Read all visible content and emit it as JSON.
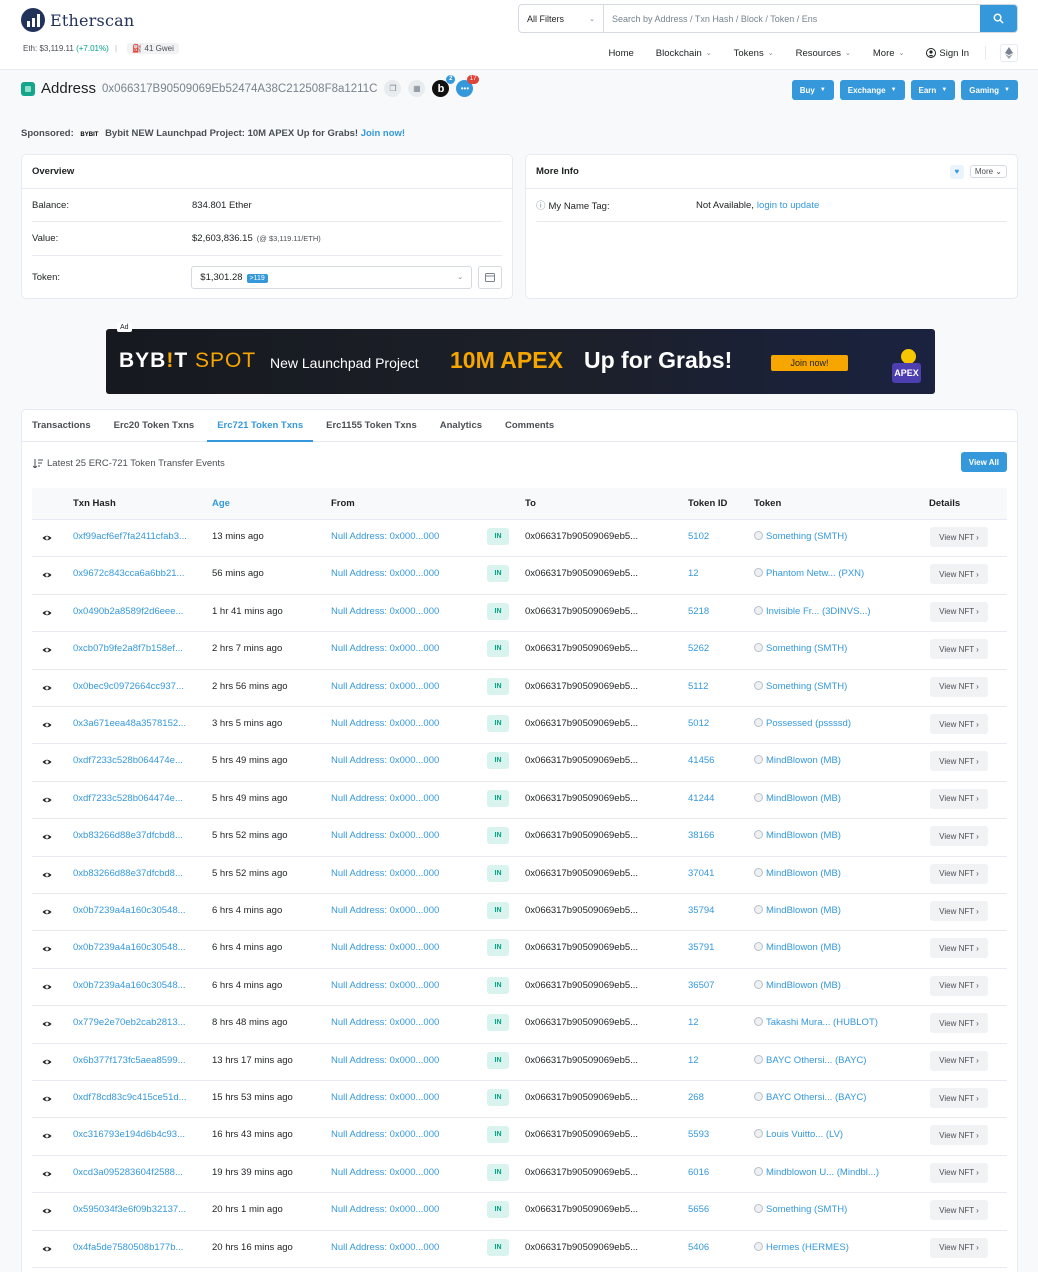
{
  "brand": {
    "name": "Etherscan"
  },
  "header": {
    "eth_label": "Eth: $3,119.11",
    "eth_change": "(+7.01%)",
    "separator": "|",
    "gas": "41 Gwei",
    "filter_label": "All Filters",
    "search_placeholder": "Search by Address / Txn Hash / Block / Token / Ens",
    "nav": [
      {
        "label": "Home",
        "dropdown": false
      },
      {
        "label": "Blockchain",
        "dropdown": true
      },
      {
        "label": "Tokens",
        "dropdown": true
      },
      {
        "label": "Resources",
        "dropdown": true
      },
      {
        "label": "More",
        "dropdown": true
      }
    ],
    "signin": "Sign In"
  },
  "address": {
    "label": "Address",
    "hash": "0x066317B90509069Eb52474A38C212508F8a1211C",
    "b_badge_count": "2",
    "chat_badge_count": "17"
  },
  "action_buttons": [
    "Buy",
    "Exchange",
    "Earn",
    "Gaming"
  ],
  "sponsored": {
    "prefix": "Sponsored:",
    "brand": "BYBIT",
    "text": "Bybit NEW Launchpad Project: 10M APEX Up for Grabs!",
    "link": "Join now!"
  },
  "overview": {
    "title": "Overview",
    "balance_label": "Balance:",
    "balance_value": "834.801 Ether",
    "value_label": "Value:",
    "value_amount": "$2,603,836.15",
    "value_rate": "(@ $3,119.11/ETH)",
    "token_label": "Token:",
    "token_value": "$1,301.28",
    "token_count": ">119"
  },
  "more_info": {
    "title": "More Info",
    "more": "More",
    "name_tag_label": "My Name Tag:",
    "name_tag_value": "Not Available,",
    "name_tag_link": "login to update"
  },
  "ad": {
    "tag": "Ad",
    "brand_a": "BYB",
    "brand_dot": "!",
    "brand_b": "T",
    "spot": "SPOT",
    "line1": "New Launchpad Project",
    "highlight": "10M APEX",
    "line2": "Up for Grabs!",
    "cta": "Join now!",
    "apex": "APEX"
  },
  "tabs": [
    {
      "label": "Transactions",
      "active": false
    },
    {
      "label": "Erc20 Token Txns",
      "active": false
    },
    {
      "label": "Erc721 Token Txns",
      "active": true
    },
    {
      "label": "Erc1155 Token Txns",
      "active": false
    },
    {
      "label": "Analytics",
      "active": false
    },
    {
      "label": "Comments",
      "active": false
    }
  ],
  "table": {
    "caption": "Latest 25 ERC-721 Token Transfer Events",
    "view_all": "View All",
    "columns": [
      "Txn Hash",
      "Age",
      "From",
      "To",
      "Token ID",
      "Token",
      "Details"
    ],
    "in_label": "IN",
    "view_nft": "View NFT",
    "rows": [
      {
        "hash": "0xf99acf6ef7fa2411cfab3...",
        "age": "13 mins ago",
        "from": "Null Address: 0x000...000",
        "to": "0x066317b90509069eb5...",
        "token_id": "5102",
        "token": "Something (SMTH)"
      },
      {
        "hash": "0x9672c843cca6a6bb21...",
        "age": "56 mins ago",
        "from": "Null Address: 0x000...000",
        "to": "0x066317b90509069eb5...",
        "token_id": "12",
        "token": "Phantom Netw... (PXN)"
      },
      {
        "hash": "0x0490b2a8589f2d6eee...",
        "age": "1 hr 41 mins ago",
        "from": "Null Address: 0x000...000",
        "to": "0x066317b90509069eb5...",
        "token_id": "5218",
        "token": "Invisible Fr... (3DINVS...)"
      },
      {
        "hash": "0xcb07b9fe2a8f7b158ef...",
        "age": "2 hrs 7 mins ago",
        "from": "Null Address: 0x000...000",
        "to": "0x066317b90509069eb5...",
        "token_id": "5262",
        "token": "Something (SMTH)"
      },
      {
        "hash": "0x0bec9c0972664cc937...",
        "age": "2 hrs 56 mins ago",
        "from": "Null Address: 0x000...000",
        "to": "0x066317b90509069eb5...",
        "token_id": "5112",
        "token": "Something (SMTH)"
      },
      {
        "hash": "0x3a671eea48a3578152...",
        "age": "3 hrs 5 mins ago",
        "from": "Null Address: 0x000...000",
        "to": "0x066317b90509069eb5...",
        "token_id": "5012",
        "token": "Possessed (pssssd)"
      },
      {
        "hash": "0xdf7233c528b064474e...",
        "age": "5 hrs 49 mins ago",
        "from": "Null Address: 0x000...000",
        "to": "0x066317b90509069eb5...",
        "token_id": "41456",
        "token": "MindBlowon (MB)"
      },
      {
        "hash": "0xdf7233c528b064474e...",
        "age": "5 hrs 49 mins ago",
        "from": "Null Address: 0x000...000",
        "to": "0x066317b90509069eb5...",
        "token_id": "41244",
        "token": "MindBlowon (MB)"
      },
      {
        "hash": "0xb83266d88e37dfcbd8...",
        "age": "5 hrs 52 mins ago",
        "from": "Null Address: 0x000...000",
        "to": "0x066317b90509069eb5...",
        "token_id": "38166",
        "token": "MindBlowon (MB)"
      },
      {
        "hash": "0xb83266d88e37dfcbd8...",
        "age": "5 hrs 52 mins ago",
        "from": "Null Address: 0x000...000",
        "to": "0x066317b90509069eb5...",
        "token_id": "37041",
        "token": "MindBlowon (MB)"
      },
      {
        "hash": "0x0b7239a4a160c30548...",
        "age": "6 hrs 4 mins ago",
        "from": "Null Address: 0x000...000",
        "to": "0x066317b90509069eb5...",
        "token_id": "35794",
        "token": "MindBlowon (MB)"
      },
      {
        "hash": "0x0b7239a4a160c30548...",
        "age": "6 hrs 4 mins ago",
        "from": "Null Address: 0x000...000",
        "to": "0x066317b90509069eb5...",
        "token_id": "35791",
        "token": "MindBlowon (MB)"
      },
      {
        "hash": "0x0b7239a4a160c30548...",
        "age": "6 hrs 4 mins ago",
        "from": "Null Address: 0x000...000",
        "to": "0x066317b90509069eb5...",
        "token_id": "36507",
        "token": "MindBlowon (MB)"
      },
      {
        "hash": "0x779e2e70eb2cab2813...",
        "age": "8 hrs 48 mins ago",
        "from": "Null Address: 0x000...000",
        "to": "0x066317b90509069eb5...",
        "token_id": "12",
        "token": "Takashi Mura... (HUBLOT)"
      },
      {
        "hash": "0x6b377f173fc5aea8599...",
        "age": "13 hrs 17 mins ago",
        "from": "Null Address: 0x000...000",
        "to": "0x066317b90509069eb5...",
        "token_id": "12",
        "token": "BAYC Othersi... (BAYC)"
      },
      {
        "hash": "0xdf78cd83c9c415ce51d...",
        "age": "15 hrs 53 mins ago",
        "from": "Null Address: 0x000...000",
        "to": "0x066317b90509069eb5...",
        "token_id": "268",
        "token": "BAYC Othersi... (BAYC)"
      },
      {
        "hash": "0xc316793e194d6b4c93...",
        "age": "16 hrs 43 mins ago",
        "from": "Null Address: 0x000...000",
        "to": "0x066317b90509069eb5...",
        "token_id": "5593",
        "token": "Louis Vuitto... (LV)"
      },
      {
        "hash": "0xcd3a095283604f2588...",
        "age": "19 hrs 39 mins ago",
        "from": "Null Address: 0x000...000",
        "to": "0x066317b90509069eb5...",
        "token_id": "6016",
        "token": "Mindblowon U... (Mindbl...)"
      },
      {
        "hash": "0x595034f3e6f09b32137...",
        "age": "20 hrs 1 min ago",
        "from": "Null Address: 0x000...000",
        "to": "0x066317b90509069eb5...",
        "token_id": "5656",
        "token": "Something (SMTH)"
      },
      {
        "hash": "0x4fa5de7580508b177b...",
        "age": "20 hrs 16 mins ago",
        "from": "Null Address: 0x000...000",
        "to": "0x066317b90509069eb5...",
        "token_id": "5406",
        "token": "Hermes (HERMES)"
      }
    ]
  },
  "colors": {
    "accent": "#3498db",
    "success": "#00a186",
    "brand_dark": "#21325b",
    "ad_orange": "#f7a600"
  }
}
